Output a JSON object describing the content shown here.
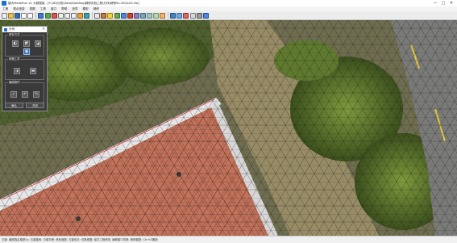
{
  "titlebar": {
    "title": "建大ModelFun v1 大数据版 - [F:\\3D\\分层\\Data\\DataSeg\\精修实验工程\\分块\\精修Sx.20\\Sx20.xfo]",
    "minimize": "—",
    "maximize": "□",
    "close": "✕"
  },
  "menubar": {
    "items": [
      "工程",
      "视点漫游",
      "视图",
      "工具",
      "窗口",
      "帮助",
      "选项",
      "模型",
      "精修"
    ]
  },
  "toolbar": {
    "icons": [
      {
        "name": "new-icon",
        "color": "#f1f1f1",
        "border": "#7a7a7a"
      },
      {
        "name": "open-icon",
        "color": "#e8c24a",
        "border": "#9a7a1c"
      },
      {
        "name": "save-icon",
        "color": "#2f6fb2",
        "border": "#1d4a7a"
      },
      {
        "name": "undo-icon",
        "color": "#ffffff",
        "border": "#7a7a7a"
      },
      {
        "name": "redo-icon",
        "color": "#ffffff",
        "border": "#7a7a7a"
      },
      {
        "name": "view-front-icon",
        "color": "#3b7dd8",
        "border": "#1d4a7a"
      },
      {
        "name": "view-top-icon",
        "color": "#56a64b",
        "border": "#2f6b28"
      },
      {
        "name": "view-side-icon",
        "color": "#d9534f",
        "border": "#8a2a27"
      },
      {
        "name": "zoom-in-icon",
        "color": "#f0f0f0",
        "border": "#6a6a6a"
      },
      {
        "name": "zoom-out-icon",
        "color": "#f0f0f0",
        "border": "#6a6a6a"
      },
      {
        "name": "pan-icon",
        "color": "#f0f0f0",
        "border": "#6a6a6a"
      },
      {
        "name": "rotate-icon",
        "color": "#e3a13a",
        "border": "#8a5f18"
      },
      {
        "name": "fit-icon",
        "color": "#3fa0a8",
        "border": "#1f6066"
      },
      {
        "name": "wireframe-icon",
        "color": "#e8e8e8",
        "border": "#6a6a6a"
      },
      {
        "name": "texture-icon",
        "color": "#bf7a3a",
        "border": "#6b3f16"
      },
      {
        "name": "light-icon",
        "color": "#f5d13b",
        "border": "#9a7f12"
      },
      {
        "name": "measure-icon",
        "color": "#6aa84f",
        "border": "#3b6a29"
      },
      {
        "name": "select-icon",
        "color": "#4a86e8",
        "border": "#24518f"
      },
      {
        "name": "delete-icon",
        "color": "#cc4125",
        "border": "#7a2514"
      },
      {
        "name": "flatten-icon",
        "color": "#8e7cc3",
        "border": "#4f3f80"
      },
      {
        "name": "fill-icon",
        "color": "#76a5af",
        "border": "#3f6a72"
      },
      {
        "name": "bridge-icon",
        "color": "#a2c4c9",
        "border": "#5d8086"
      },
      {
        "name": "smooth-icon",
        "color": "#b6d7a8",
        "border": "#6c8f5d"
      },
      {
        "name": "texture-fix-icon",
        "color": "#f6b26b",
        "border": "#9a6a2f"
      },
      {
        "name": "export-icon",
        "color": "#3d85c6",
        "border": "#1f4f80"
      },
      {
        "name": "import-icon",
        "color": "#6fa8dc",
        "border": "#356a96"
      },
      {
        "name": "layers-icon",
        "color": "#e06666",
        "border": "#8a3434"
      },
      {
        "name": "grid-icon",
        "color": "#d9d9d9",
        "border": "#7a7a7a"
      },
      {
        "name": "settings-icon",
        "color": "#999999",
        "border": "#555555"
      },
      {
        "name": "help-icon",
        "color": "#4a86e8",
        "border": "#24518f"
      }
    ]
  },
  "panel": {
    "title": "分块",
    "close": "✕",
    "groups": [
      {
        "label": "修补方式"
      },
      {
        "label": "网格工具"
      },
      {
        "label": "编辑操作"
      }
    ],
    "footer": [
      "确认",
      "关闭"
    ]
  },
  "status": {
    "text": "左键: 编辑选定模型Sx; 右键旋转; 中键平移; 滚轮缩放; 左键双击: 切换视图; 保存工程修改; 编辑窗口切换: 精修模型; Ctrl+Z撤销"
  }
}
